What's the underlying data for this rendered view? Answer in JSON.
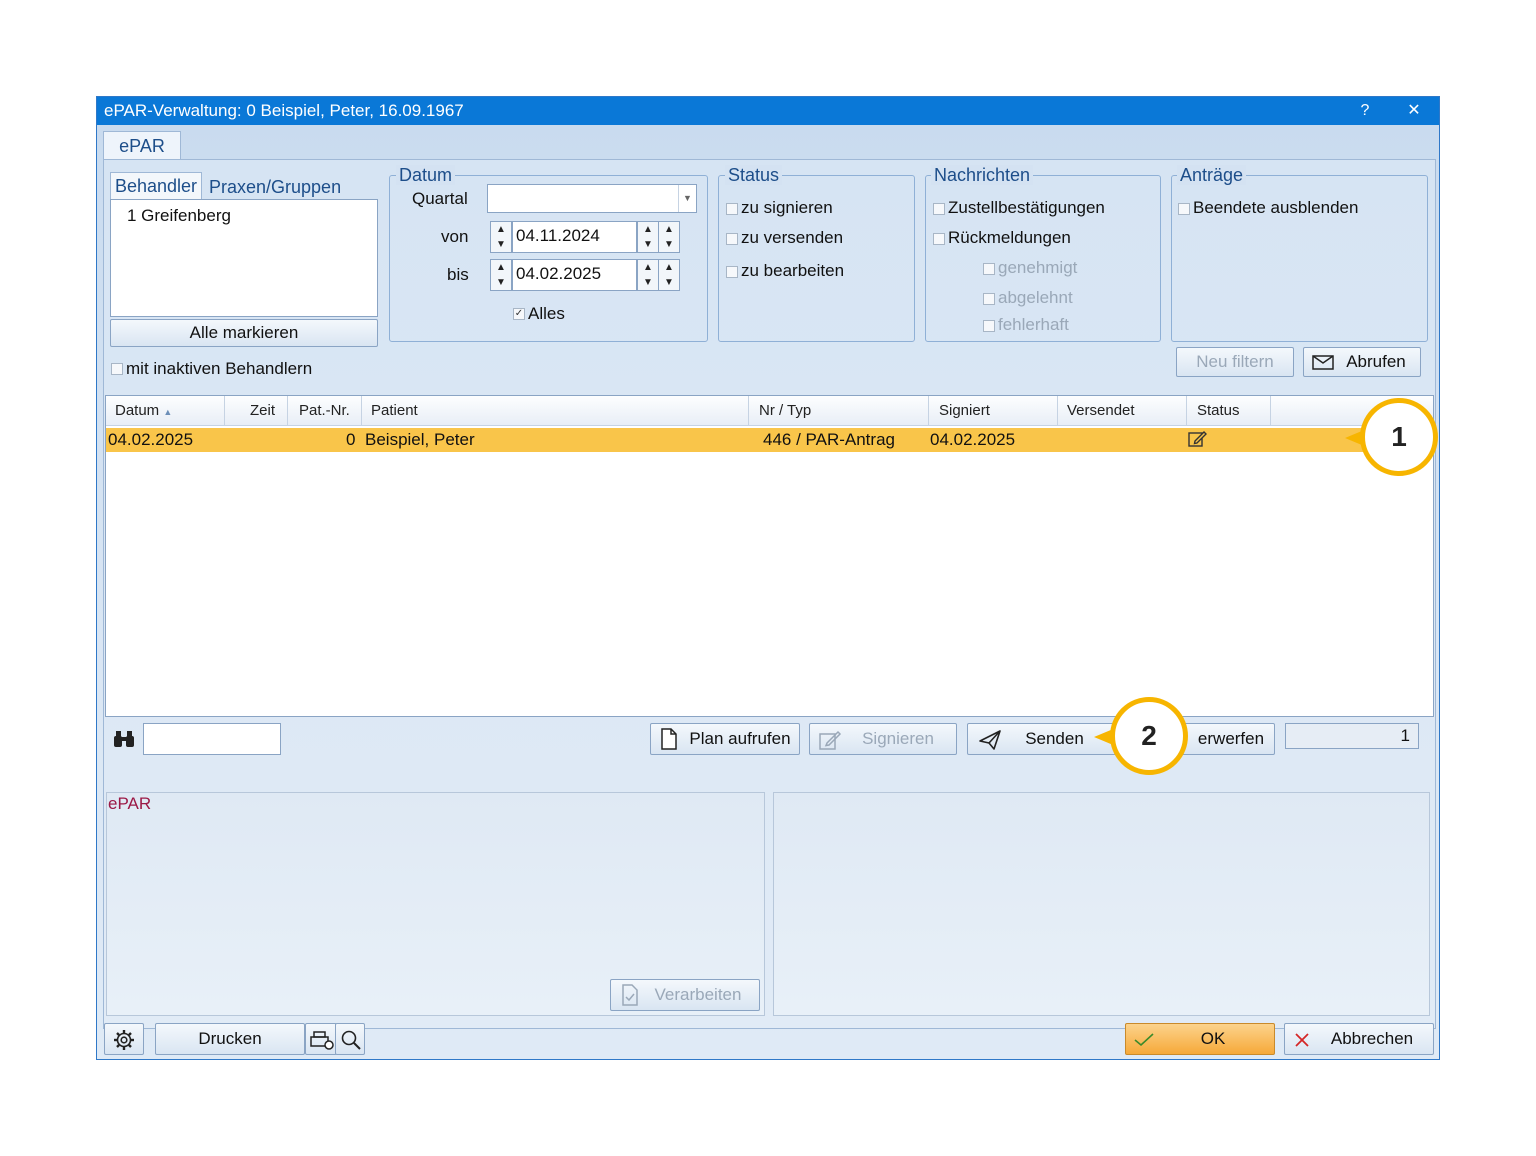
{
  "window": {
    "title": "ePAR-Verwaltung: 0 Beispiel, Peter, 16.09.1967",
    "help_glyph": "?",
    "close_glyph": "✕"
  },
  "main_tab": "ePAR",
  "left_tabs": {
    "behandler": "Behandler",
    "praxen": "Praxen/Gruppen"
  },
  "behandler_list": [
    "1 Greifenberg"
  ],
  "alle_markieren": "Alle markieren",
  "mit_inaktiven": "mit inaktiven Behandlern",
  "datum": {
    "legend": "Datum",
    "quartal_label": "Quartal",
    "quartal_value": "",
    "von_label": "von",
    "von_value": "04.11.2024",
    "bis_label": "bis",
    "bis_value": "04.02.2025",
    "alles_label": "Alles"
  },
  "status": {
    "legend": "Status",
    "items": [
      "zu signieren",
      "zu versenden",
      "zu bearbeiten"
    ]
  },
  "nachrichten": {
    "legend": "Nachrichten",
    "items": [
      "Zustellbestätigungen",
      "Rückmeldungen"
    ],
    "sub_items": [
      "genehmigt",
      "abgelehnt",
      "fehlerhaft"
    ]
  },
  "antraege": {
    "legend": "Anträge",
    "items": [
      "Beendete ausblenden"
    ]
  },
  "buttons": {
    "neu_filtern": "Neu filtern",
    "abrufen": "Abrufen"
  },
  "table": {
    "columns": [
      "Datum",
      "Zeit",
      "Pat.-Nr.",
      "Patient",
      "Nr / Typ",
      "Signiert",
      "Versendet",
      "Status"
    ],
    "sort_glyph": "▲",
    "rows": [
      {
        "datum": "04.02.2025",
        "zeit": "",
        "patnr": "0",
        "patient": "Beispiel, Peter",
        "nrtyp": "446 / PAR-Antrag",
        "signiert": "04.02.2025",
        "versendet": "",
        "status_icon": "edit-icon"
      }
    ],
    "highlight_color": "#f9c54a"
  },
  "actions": {
    "search_value": "",
    "plan_aufrufen": "Plan aufrufen",
    "signieren": "Signieren",
    "senden": "Senden",
    "verwerfen": "erwerfen",
    "count": "1"
  },
  "callouts": [
    "1",
    "2"
  ],
  "lower_left_title": "ePAR",
  "verarbeiten": "Verarbeiten",
  "footer": {
    "drucken": "Drucken",
    "ok": "OK",
    "abbrechen": "Abbrechen"
  },
  "colors": {
    "title_bar": "#0a78d7",
    "callout": "#f7b500",
    "ok_button": "#f9b84a",
    "epar_title": "#9b1845"
  }
}
